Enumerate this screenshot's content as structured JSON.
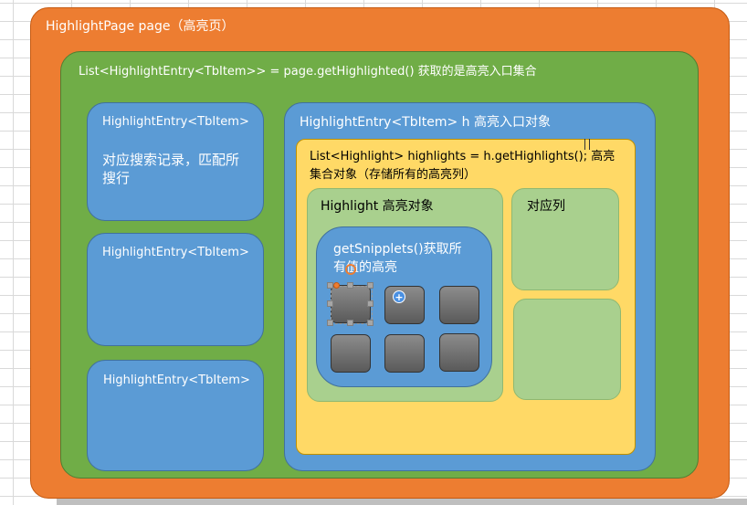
{
  "page": {
    "title": "HighlightPage  page（高亮页）"
  },
  "list": {
    "title": "List<HighlightEntry<TbItem>>   =  page.getHighlighted() 获取的是高亮入口集合"
  },
  "entries": [
    {
      "title": "HighlightEntry<TbItem>",
      "desc": "对应搜索记录，匹配所搜行"
    },
    {
      "title": "HighlightEntry<TbItem>"
    },
    {
      "title": "HighlightEntry<TbItem>"
    }
  ],
  "entry_h": {
    "title": "HighlightEntry<TbItem> h  高亮入口对象"
  },
  "highlights": {
    "title": "List<Highlight> highlights = h.getHighlights(); 高亮集合对象（存储所有的高亮列）"
  },
  "highlight": {
    "title": "Highlight 高亮对象"
  },
  "snipplets": {
    "title": "getSnipplets()获取所有值的高亮"
  },
  "column": {
    "title": "对应列"
  },
  "colors": {
    "orange": "#ed7d31",
    "green": "#70ad47",
    "blue": "#5b9bd5",
    "yellow": "#ffd966",
    "light_green": "#a9d08e",
    "button_gray": "#6e6e6e"
  }
}
